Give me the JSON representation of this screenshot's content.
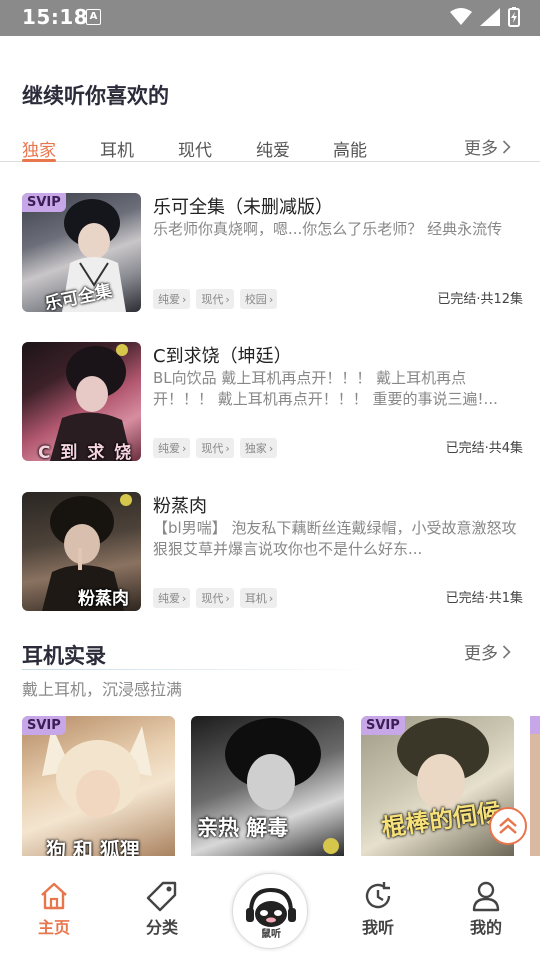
{
  "status_bar": {
    "time": "15:18",
    "notification_icon": "A"
  },
  "continue_section": {
    "title": "继续听你喜欢的",
    "tabs": [
      "独家",
      "耳机",
      "现代",
      "纯爱",
      "高能"
    ],
    "more_label": "更多"
  },
  "items": [
    {
      "title": "乐可全集（未删减版）",
      "desc": "乐老师你真烧啊，嗯...你怎么了乐老师？ 经典永流传",
      "tags": [
        "纯爱",
        "现代",
        "校园"
      ],
      "status": "已完结·共12集",
      "badge": "SVIP",
      "cover_caption": "乐可全集"
    },
    {
      "title": "C到求饶（坤廷）",
      "desc": "BL向饮品 戴上耳机再点开！！！ 戴上耳机再点开！！！ 戴上耳机再点开！！！ 重要的事说三遍!...",
      "tags": [
        "纯爱",
        "现代",
        "独家"
      ],
      "status": "已完结·共4集",
      "cover_caption": "C 到 求 饶"
    },
    {
      "title": "粉蒸肉",
      "desc": "【bl男喘】 泡友私下藕断丝连戴绿帽，小受故意激怒攻 狠狠艾草并爆言说攻你也不是什么好东...",
      "tags": [
        "纯爱",
        "现代",
        "耳机"
      ],
      "status": "已完结·共1集",
      "cover_caption": "粉蒸肉"
    }
  ],
  "earphone_section": {
    "title": "耳机实录",
    "more_label": "更多",
    "subtitle": "戴上耳机，沉浸感拉满",
    "covers": [
      {
        "badge": "SVIP",
        "caption": "狗 和 狐狸"
      },
      {
        "badge": "",
        "caption": "亲热 解毒"
      },
      {
        "badge": "SVIP",
        "caption": "棍棒的伺候"
      }
    ]
  },
  "bottom_nav": {
    "items": [
      "主页",
      "分类",
      "我听",
      "我的"
    ],
    "center_label": "鼠听"
  },
  "colors": {
    "accent": "#e8764d",
    "svip": "#c8a7e8"
  }
}
